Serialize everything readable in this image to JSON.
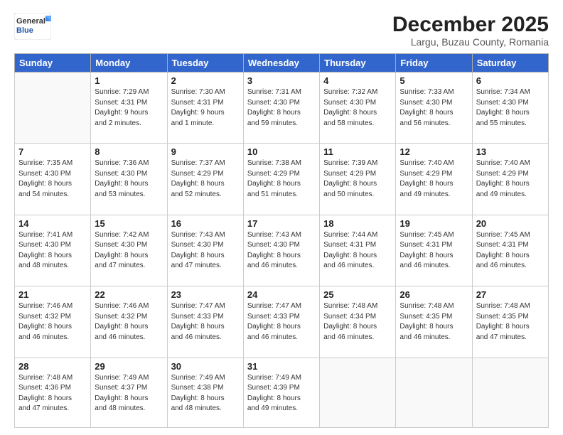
{
  "header": {
    "logo_general": "General",
    "logo_blue": "Blue",
    "month_year": "December 2025",
    "location": "Largu, Buzau County, Romania"
  },
  "days_of_week": [
    "Sunday",
    "Monday",
    "Tuesday",
    "Wednesday",
    "Thursday",
    "Friday",
    "Saturday"
  ],
  "weeks": [
    [
      {
        "day": "",
        "content": ""
      },
      {
        "day": "1",
        "content": "Sunrise: 7:29 AM\nSunset: 4:31 PM\nDaylight: 9 hours\nand 2 minutes."
      },
      {
        "day": "2",
        "content": "Sunrise: 7:30 AM\nSunset: 4:31 PM\nDaylight: 9 hours\nand 1 minute."
      },
      {
        "day": "3",
        "content": "Sunrise: 7:31 AM\nSunset: 4:30 PM\nDaylight: 8 hours\nand 59 minutes."
      },
      {
        "day": "4",
        "content": "Sunrise: 7:32 AM\nSunset: 4:30 PM\nDaylight: 8 hours\nand 58 minutes."
      },
      {
        "day": "5",
        "content": "Sunrise: 7:33 AM\nSunset: 4:30 PM\nDaylight: 8 hours\nand 56 minutes."
      },
      {
        "day": "6",
        "content": "Sunrise: 7:34 AM\nSunset: 4:30 PM\nDaylight: 8 hours\nand 55 minutes."
      }
    ],
    [
      {
        "day": "7",
        "content": "Sunrise: 7:35 AM\nSunset: 4:30 PM\nDaylight: 8 hours\nand 54 minutes."
      },
      {
        "day": "8",
        "content": "Sunrise: 7:36 AM\nSunset: 4:30 PM\nDaylight: 8 hours\nand 53 minutes."
      },
      {
        "day": "9",
        "content": "Sunrise: 7:37 AM\nSunset: 4:29 PM\nDaylight: 8 hours\nand 52 minutes."
      },
      {
        "day": "10",
        "content": "Sunrise: 7:38 AM\nSunset: 4:29 PM\nDaylight: 8 hours\nand 51 minutes."
      },
      {
        "day": "11",
        "content": "Sunrise: 7:39 AM\nSunset: 4:29 PM\nDaylight: 8 hours\nand 50 minutes."
      },
      {
        "day": "12",
        "content": "Sunrise: 7:40 AM\nSunset: 4:29 PM\nDaylight: 8 hours\nand 49 minutes."
      },
      {
        "day": "13",
        "content": "Sunrise: 7:40 AM\nSunset: 4:29 PM\nDaylight: 8 hours\nand 49 minutes."
      }
    ],
    [
      {
        "day": "14",
        "content": "Sunrise: 7:41 AM\nSunset: 4:30 PM\nDaylight: 8 hours\nand 48 minutes."
      },
      {
        "day": "15",
        "content": "Sunrise: 7:42 AM\nSunset: 4:30 PM\nDaylight: 8 hours\nand 47 minutes."
      },
      {
        "day": "16",
        "content": "Sunrise: 7:43 AM\nSunset: 4:30 PM\nDaylight: 8 hours\nand 47 minutes."
      },
      {
        "day": "17",
        "content": "Sunrise: 7:43 AM\nSunset: 4:30 PM\nDaylight: 8 hours\nand 46 minutes."
      },
      {
        "day": "18",
        "content": "Sunrise: 7:44 AM\nSunset: 4:31 PM\nDaylight: 8 hours\nand 46 minutes."
      },
      {
        "day": "19",
        "content": "Sunrise: 7:45 AM\nSunset: 4:31 PM\nDaylight: 8 hours\nand 46 minutes."
      },
      {
        "day": "20",
        "content": "Sunrise: 7:45 AM\nSunset: 4:31 PM\nDaylight: 8 hours\nand 46 minutes."
      }
    ],
    [
      {
        "day": "21",
        "content": "Sunrise: 7:46 AM\nSunset: 4:32 PM\nDaylight: 8 hours\nand 46 minutes."
      },
      {
        "day": "22",
        "content": "Sunrise: 7:46 AM\nSunset: 4:32 PM\nDaylight: 8 hours\nand 46 minutes."
      },
      {
        "day": "23",
        "content": "Sunrise: 7:47 AM\nSunset: 4:33 PM\nDaylight: 8 hours\nand 46 minutes."
      },
      {
        "day": "24",
        "content": "Sunrise: 7:47 AM\nSunset: 4:33 PM\nDaylight: 8 hours\nand 46 minutes."
      },
      {
        "day": "25",
        "content": "Sunrise: 7:48 AM\nSunset: 4:34 PM\nDaylight: 8 hours\nand 46 minutes."
      },
      {
        "day": "26",
        "content": "Sunrise: 7:48 AM\nSunset: 4:35 PM\nDaylight: 8 hours\nand 46 minutes."
      },
      {
        "day": "27",
        "content": "Sunrise: 7:48 AM\nSunset: 4:35 PM\nDaylight: 8 hours\nand 47 minutes."
      }
    ],
    [
      {
        "day": "28",
        "content": "Sunrise: 7:48 AM\nSunset: 4:36 PM\nDaylight: 8 hours\nand 47 minutes."
      },
      {
        "day": "29",
        "content": "Sunrise: 7:49 AM\nSunset: 4:37 PM\nDaylight: 8 hours\nand 48 minutes."
      },
      {
        "day": "30",
        "content": "Sunrise: 7:49 AM\nSunset: 4:38 PM\nDaylight: 8 hours\nand 48 minutes."
      },
      {
        "day": "31",
        "content": "Sunrise: 7:49 AM\nSunset: 4:39 PM\nDaylight: 8 hours\nand 49 minutes."
      },
      {
        "day": "",
        "content": ""
      },
      {
        "day": "",
        "content": ""
      },
      {
        "day": "",
        "content": ""
      }
    ]
  ]
}
